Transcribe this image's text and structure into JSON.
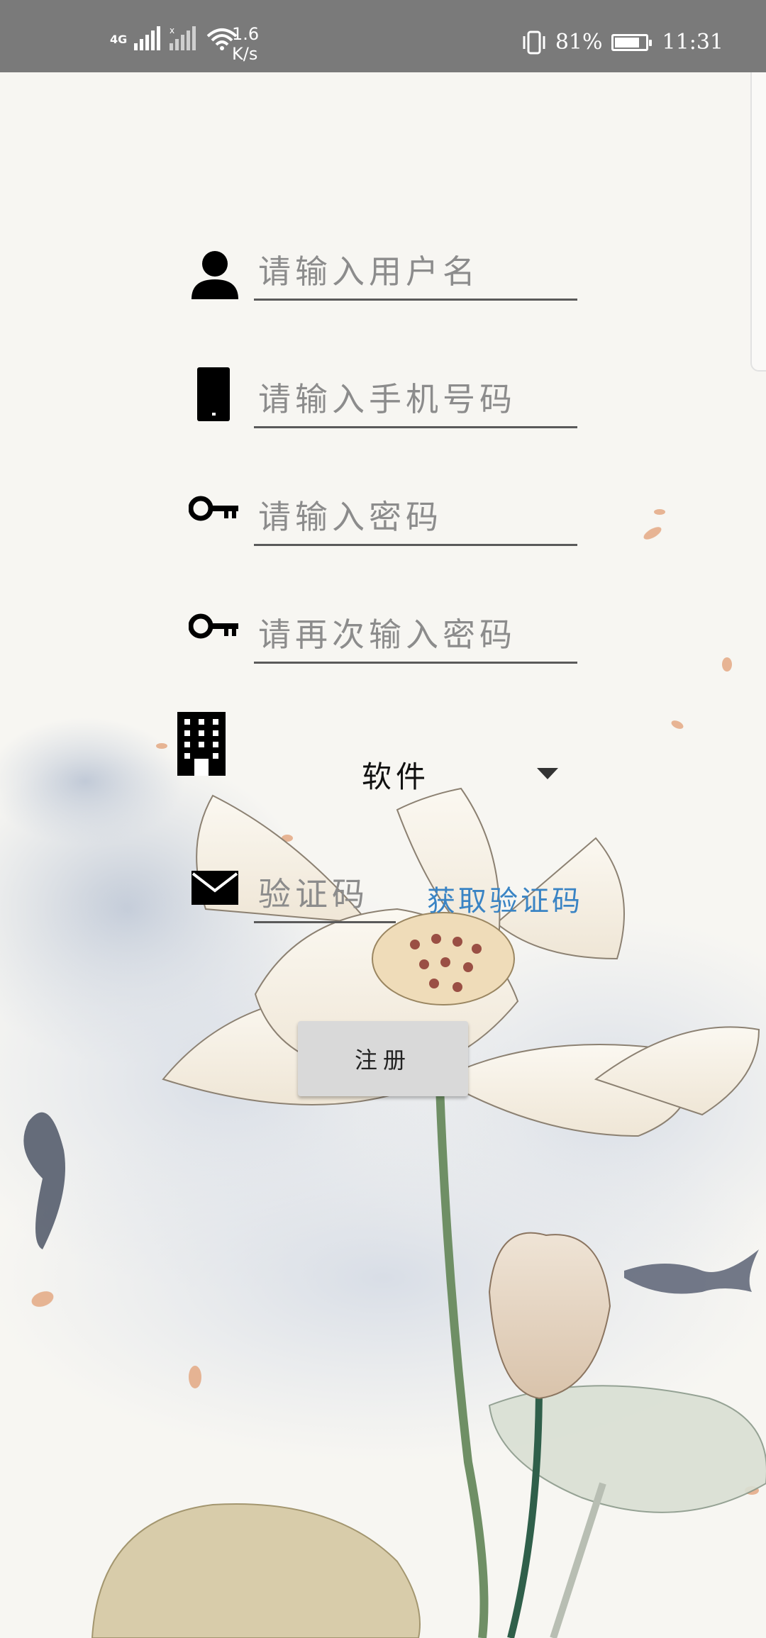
{
  "status_bar": {
    "network_label": "4G",
    "net_speed_value": "1.6",
    "net_speed_unit": "K/s",
    "battery_percent_text": "81%",
    "battery_level": 0.81,
    "time": "11:31"
  },
  "form": {
    "username_placeholder": "请输入用户名",
    "phone_placeholder": "请输入手机号码",
    "password_placeholder": "请输入密码",
    "confirm_password_placeholder": "请再次输入密码",
    "department_selected": "软件",
    "code_placeholder": "验证码",
    "get_code_label": "获取验证码",
    "register_label": "注册"
  },
  "colors": {
    "status_bar_bg": "#7a7a7a",
    "link_blue": "#3a84c4",
    "button_bg": "#d9d9d9",
    "underline": "#5a5a5a"
  }
}
